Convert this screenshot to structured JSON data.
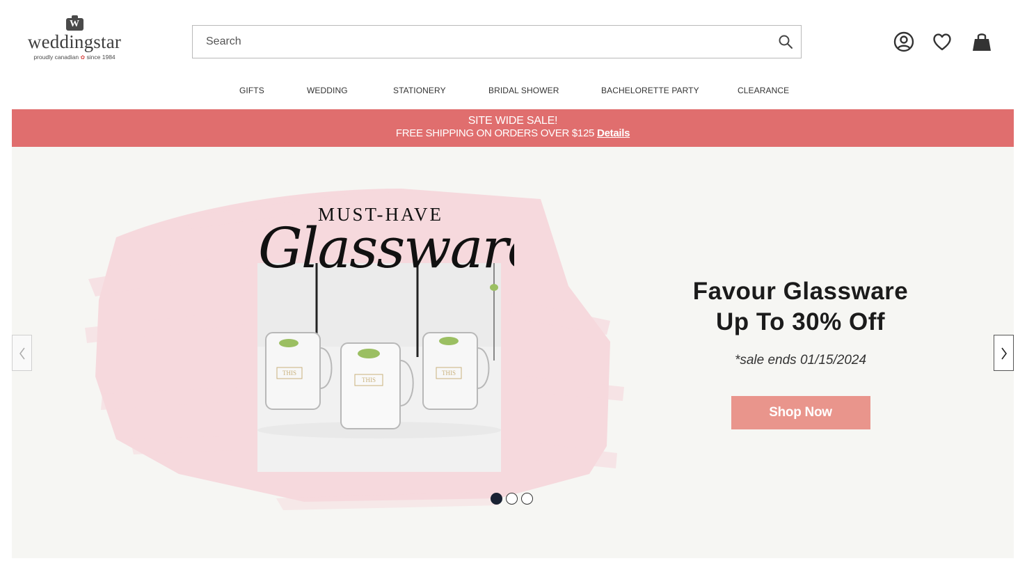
{
  "header": {
    "logo": {
      "badge": "W",
      "wordmark": "weddingstar",
      "tagline_left": "proudly canadian",
      "tagline_right": "since 1984"
    },
    "search": {
      "placeholder": "Search",
      "value": ""
    },
    "icons": [
      "account-icon",
      "wishlist-heart-icon",
      "shopping-bag-icon"
    ]
  },
  "nav": {
    "items": [
      {
        "label": "GIFTS"
      },
      {
        "label": "WEDDING"
      },
      {
        "label": "STATIONERY"
      },
      {
        "label": "BRIDAL SHOWER"
      },
      {
        "label": "BACHELORETTE PARTY"
      },
      {
        "label": "CLEARANCE"
      }
    ]
  },
  "promo": {
    "line1": "SITE WIDE SALE!",
    "line2": "FREE SHIPPING ON ORDERS OVER $125",
    "link": "Details"
  },
  "hero": {
    "image_heading": "MUST-HAVE",
    "image_script": "Glassware",
    "title_line1": "Favour Glassware",
    "title_line2": "Up To 30% Off",
    "subtitle": "*sale ends 01/15/2024",
    "cta": "Shop Now",
    "jar_labels": [
      "THIS",
      "THIS",
      "THIS"
    ],
    "slides_total": 3,
    "active_slide": 1
  },
  "colors": {
    "promo_bg": "#e06e6e",
    "cta_bg": "#e9958c",
    "hero_bg": "#f6f6f3",
    "brush_pink": "#f6d9dd",
    "dot_active": "#1a2233"
  }
}
